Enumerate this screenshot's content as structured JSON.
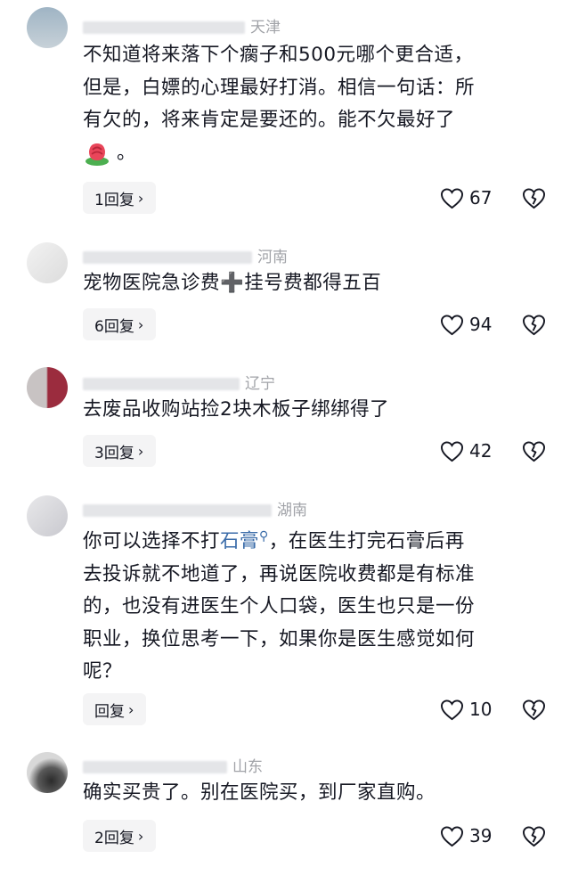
{
  "comments": [
    {
      "location": "天津",
      "text_lines": [
        "不知道将来落下个瘸子和500元哪个更合适，",
        "但是，白嫖的心理最好打消。相信一句话：所",
        "有欠的，将来肯定是要还的。能不欠最好了"
      ],
      "text_end": "。",
      "emoji": "rose-emoji",
      "reply_label": "1回复",
      "likes": "67"
    },
    {
      "location": "河南",
      "text_lines": [
        "宠物医院急诊费➕挂号费都得五百"
      ],
      "reply_label": "6回复",
      "likes": "94"
    },
    {
      "location": "辽宁",
      "text_lines": [
        "去废品收购站捡2块木板子绑绑得了"
      ],
      "reply_label": "3回复",
      "likes": "42"
    },
    {
      "location": "湖南",
      "text_first_prefix": "你可以选择不打",
      "text_link": "石膏",
      "text_first_suffix": "，在医生打完石膏后再",
      "text_lines": [
        "去投诉就不地道了，再说医院收费都是有标准",
        "的，也没有进医生个人口袋，医生也只是一份",
        "职业，换位思考一下，如果你是医生感觉如何",
        "呢？"
      ],
      "reply_label": "回复",
      "likes": "10"
    },
    {
      "location": "山东",
      "text_lines": [
        "确实买贵了。别在医院买，到厂家直购。"
      ],
      "reply_label": "2回复",
      "likes": "39"
    }
  ],
  "icons": {
    "like": "heart-outline-icon",
    "dislike": "broken-heart-icon",
    "chevron": "chevron-right-icon",
    "search": "search-icon"
  },
  "colors": {
    "text": "#161823",
    "meta": "#a1a3a8",
    "link": "#3b6ca9",
    "reply_bg": "#f4f4f5"
  }
}
